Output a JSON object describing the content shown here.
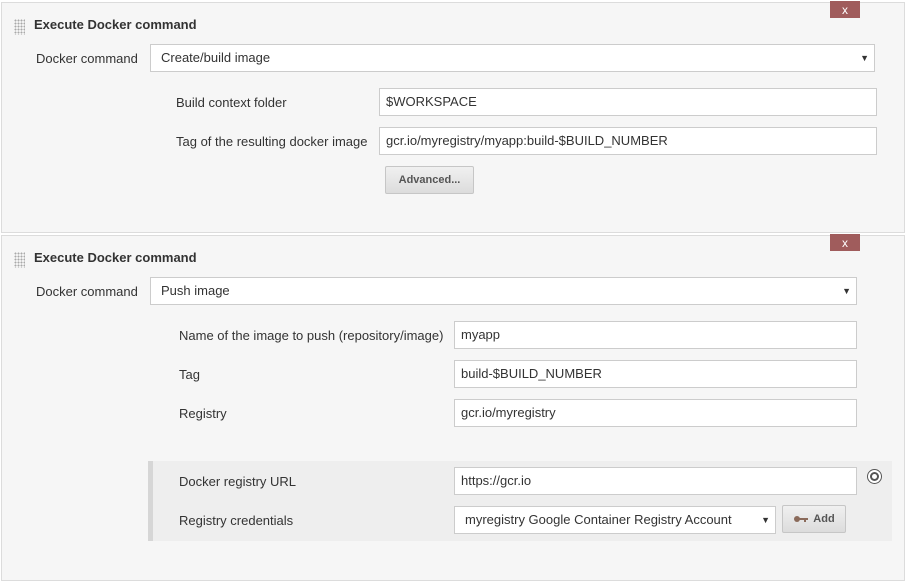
{
  "step1": {
    "title": "Execute Docker command",
    "close_label": "x",
    "docker_command_label": "Docker command",
    "docker_command_value": "Create/build image",
    "build_context_label": "Build context folder",
    "build_context_value": "$WORKSPACE",
    "tag_label": "Tag of the resulting docker image",
    "tag_value": "gcr.io/myregistry/myapp:build-$BUILD_NUMBER",
    "advanced_label": "Advanced..."
  },
  "step2": {
    "title": "Execute Docker command",
    "close_label": "x",
    "docker_command_label": "Docker command",
    "docker_command_value": "Push image",
    "image_name_label": "Name of the image to push (repository/image)",
    "image_name_value": "myapp",
    "tag_label": "Tag",
    "tag_value": "build-$BUILD_NUMBER",
    "registry_label": "Registry",
    "registry_value": "gcr.io/myregistry",
    "registry_url_label": "Docker registry URL",
    "registry_url_value": "https://gcr.io",
    "credentials_label": "Registry credentials",
    "credentials_value": "myregistry Google Container Registry Account",
    "add_label": "Add"
  },
  "icons": {
    "grip": "drag-handle-icon",
    "caret": "chevron-down-icon",
    "help": "help-icon",
    "key": "key-icon"
  },
  "colors": {
    "close_button": "#a05c5c",
    "panel_bg": "#f6f6f6",
    "credentials_bg": "#eeeeee"
  }
}
